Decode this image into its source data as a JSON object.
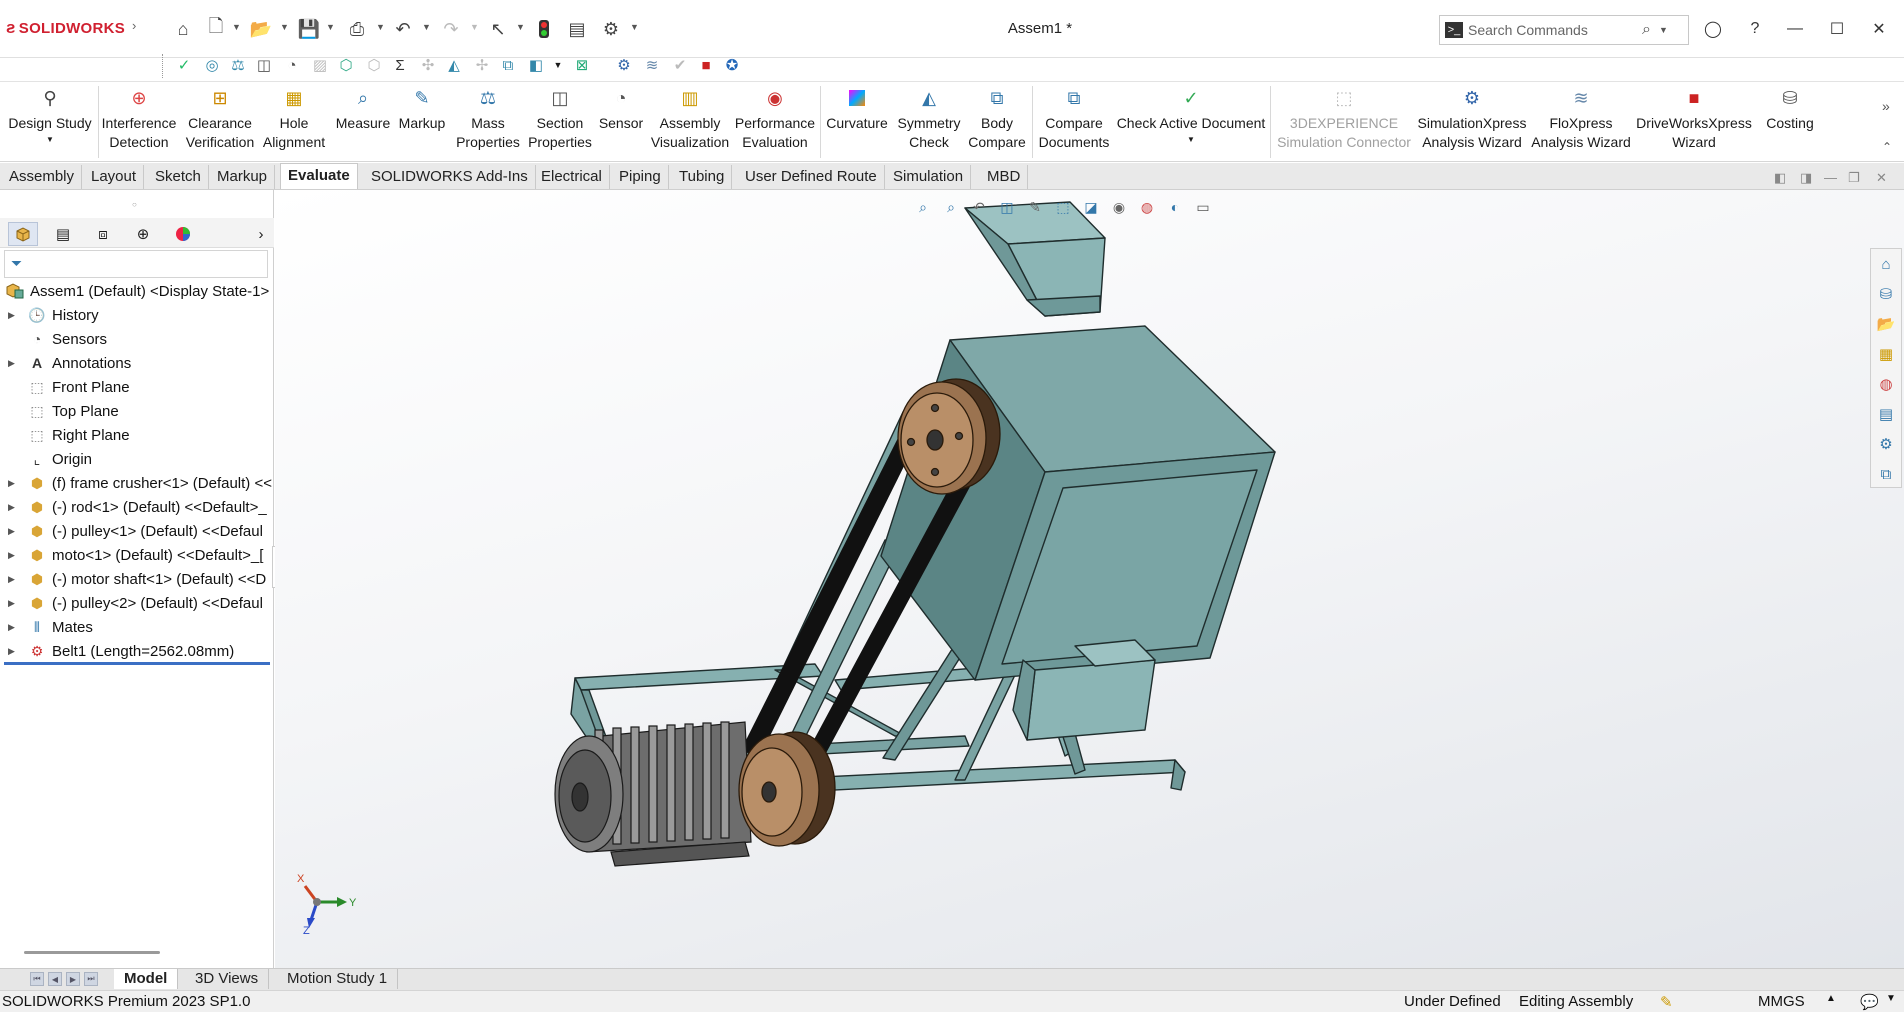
{
  "app": {
    "logo_text": "SOLIDWORKS",
    "document_title": "Assem1 *"
  },
  "search": {
    "placeholder": "Search Commands"
  },
  "command_manager": {
    "buttons": [
      {
        "label": "Design Study",
        "icon": "design-study-icon"
      },
      {
        "label": "Interference Detection",
        "icon": "interference-icon"
      },
      {
        "label": "Clearance Verification",
        "icon": "clearance-icon"
      },
      {
        "label": "Hole Alignment",
        "icon": "hole-alignment-icon"
      },
      {
        "label": "Measure",
        "icon": "measure-icon"
      },
      {
        "label": "Markup",
        "icon": "markup-icon"
      },
      {
        "label": "Mass Properties",
        "icon": "mass-properties-icon"
      },
      {
        "label": "Section Properties",
        "icon": "section-properties-icon"
      },
      {
        "label": "Sensor",
        "icon": "sensor-icon"
      },
      {
        "label": "Assembly Visualization",
        "icon": "assembly-visualization-icon"
      },
      {
        "label": "Performance Evaluation",
        "icon": "performance-icon"
      },
      {
        "label": "Curvature",
        "icon": "curvature-icon"
      },
      {
        "label": "Symmetry Check",
        "icon": "symmetry-icon"
      },
      {
        "label": "Body Compare",
        "icon": "body-compare-icon"
      },
      {
        "label": "Compare Documents",
        "icon": "compare-documents-icon"
      },
      {
        "label": "Check Active Document",
        "icon": "check-document-icon"
      },
      {
        "label": "3DEXPERIENCE Simulation Connector",
        "icon": "simulation-connector-icon"
      },
      {
        "label": "SimulationXpress Analysis Wizard",
        "icon": "simulationxpress-icon"
      },
      {
        "label": "FloXpress Analysis Wizard",
        "icon": "floxpress-icon"
      },
      {
        "label": "DriveWorksXpress Wizard",
        "icon": "driveworks-icon"
      },
      {
        "label": "Costing",
        "icon": "costing-icon"
      }
    ]
  },
  "tabs": [
    "Assembly",
    "Layout",
    "Sketch",
    "Markup",
    "Evaluate",
    "SOLIDWORKS Add-Ins",
    "Electrical",
    "Piping",
    "Tubing",
    "User Defined Route",
    "Simulation",
    "MBD"
  ],
  "active_tab": "Evaluate",
  "feature_tree": {
    "root": "Assem1 (Default) <Display State-1>",
    "items": [
      "History",
      "Sensors",
      "Annotations",
      "Front Plane",
      "Top Plane",
      "Right Plane",
      "Origin",
      "(f) frame crusher<1> (Default) <<",
      "(-) rod<1> (Default) <<Default>_",
      "(-) pulley<1> (Default) <<Defaul",
      "moto<1> (Default) <<Default>_[",
      "(-) motor shaft<1> (Default) <<D",
      "(-) pulley<2> (Default) <<Defaul",
      "Mates",
      "Belt1 (Length=2562.08mm)"
    ]
  },
  "triad": {
    "x": "X",
    "y": "Y",
    "z": "Z"
  },
  "bottom_tabs": [
    "Model",
    "3D Views",
    "Motion Study 1"
  ],
  "status_bar": {
    "product": "SOLIDWORKS Premium 2023 SP1.0",
    "definition": "Under Defined",
    "mode": "Editing Assembly",
    "units": "MMGS"
  },
  "colors": {
    "accent_red": "#d02030",
    "model_teal": "#7fa8a8",
    "tree_highlight": "#3b6fc4"
  }
}
